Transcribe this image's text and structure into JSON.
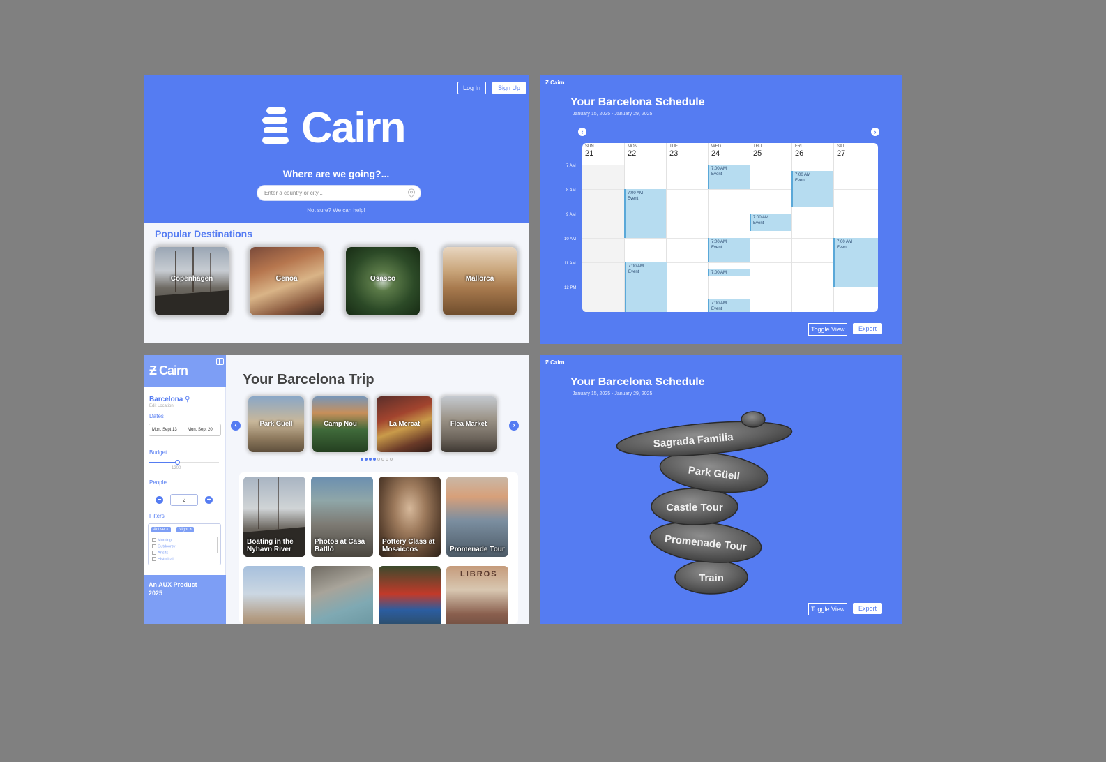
{
  "landing": {
    "login_label": "Log In",
    "signup_label": "Sign Up",
    "brand": "Cairn",
    "question": "Where are we going?...",
    "search_placeholder": "Enter a country or city...",
    "help_link": "Not sure? We can help!",
    "popular_title": "Popular Destinations",
    "destinations": [
      {
        "name": "Copenhagen"
      },
      {
        "name": "Genoa"
      },
      {
        "name": "Osasco"
      },
      {
        "name": "Mallorca"
      }
    ]
  },
  "schedule": {
    "brand": "Cairn",
    "title": "Your Barcelona Schedule",
    "date_range": "January 15, 2025 - January 29, 2025",
    "prev_icon": "chevron-left-icon",
    "next_icon": "chevron-right-icon",
    "days": [
      {
        "name": "SUN",
        "num": "21"
      },
      {
        "name": "MON",
        "num": "22"
      },
      {
        "name": "TUE",
        "num": "23"
      },
      {
        "name": "WED",
        "num": "24"
      },
      {
        "name": "THU",
        "num": "25"
      },
      {
        "name": "FRI",
        "num": "26"
      },
      {
        "name": "SAT",
        "num": "27"
      }
    ],
    "times": [
      "7 AM",
      "8 AM",
      "9 AM",
      "10 AM",
      "11 AM",
      "12 PM"
    ],
    "event_time": "7:00 AM",
    "event_title": "Event",
    "toggle_label": "Toggle View",
    "export_label": "Export"
  },
  "stack_view": {
    "brand": "Cairn",
    "title": "Your Barcelona Schedule",
    "date_range": "January 15, 2025 - January 29, 2025",
    "stones": [
      "Sagrada Familia",
      "Park Güell",
      "Castle Tour",
      "Promenade Tour",
      "Train"
    ],
    "toggle_label": "Toggle View",
    "export_label": "Export"
  },
  "trip": {
    "brand": "Cairn",
    "city": "Barcelona",
    "edit_location": "Edit Location",
    "dates_label": "Dates",
    "date_start": "Mon, Sept 13",
    "date_end": "Mon, Sept 20",
    "budget_label": "Budget",
    "budget_value": "1200",
    "budget_fraction": 0.4,
    "people_label": "People",
    "people_value": "2",
    "filters_label": "Filters",
    "chips": [
      "Active",
      "Night"
    ],
    "filter_options": [
      "Morning",
      "Outdoorsy",
      "Artsitc",
      "Historical"
    ],
    "footer": "An AUX Product 2025",
    "title": "Your Barcelona Trip",
    "carousel": [
      "Park Güell",
      "Camp Nou",
      "La Mercat",
      "Flea Market"
    ],
    "carousel_page": 4,
    "carousel_pages": 8,
    "activities": [
      "Boating in the Nyhavn River",
      "Photos at Casa Batlló",
      "Pottery Class at Mosaiccos",
      "Promenade Tour",
      "",
      "",
      "",
      ""
    ],
    "shop_sign": "LIBROS"
  },
  "colors": {
    "brand_blue": "#557cf2",
    "light_blue": "#7d9ef5",
    "event_blue": "#b6dcf0",
    "canvas_gray": "#808080"
  }
}
